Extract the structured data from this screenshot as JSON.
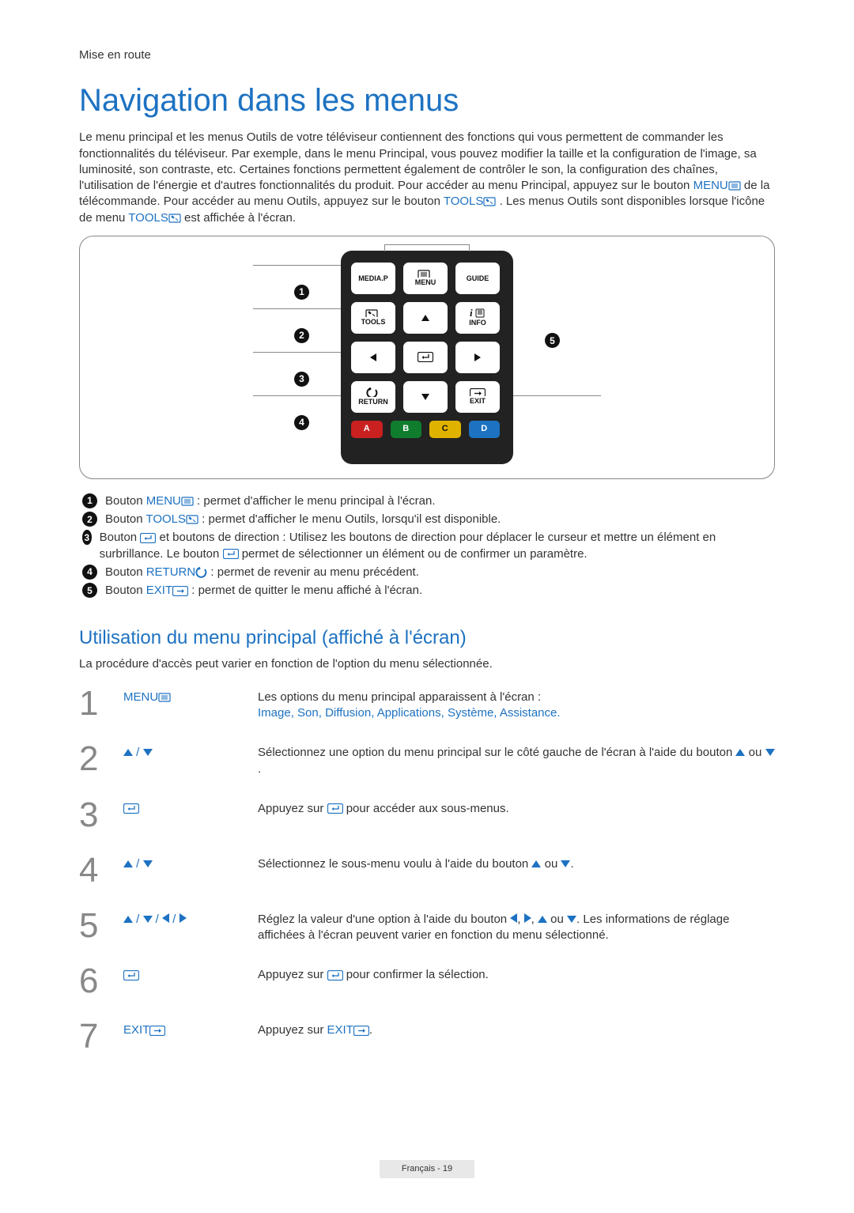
{
  "breadcrumb": "Mise en route",
  "title": "Navigation dans les menus",
  "intro": {
    "pre": "Le menu principal et les menus Outils de votre téléviseur contiennent des fonctions qui vous permettent de commander les fonctionnalités du téléviseur. Par exemple, dans le menu Principal, vous pouvez modifier la taille et la configuration de l'image, sa luminosité, son contraste, etc. Certaines fonctions permettent également de contrôler le son, la configuration des chaînes, l'utilisation de l'énergie et d'autres fonctionnalités du produit. Pour accéder au menu Principal, appuyez sur le bouton ",
    "menu": "MENU",
    "mid1": " de la télécommande. Pour accéder au menu Outils, appuyez sur le bouton ",
    "tools1": "TOOLS",
    "mid2": ". Les menus Outils sont disponibles lorsque l'icône de menu ",
    "tools2": "TOOLS",
    "post": " est affichée à l'écran."
  },
  "remote": {
    "mediap": "MEDIA.P",
    "menu": "MENU",
    "guide": "GUIDE",
    "tools": "TOOLS",
    "info": "INFO",
    "return": "RETURN",
    "exit": "EXIT",
    "a": "A",
    "b": "B",
    "c": "C",
    "d": "D"
  },
  "callouts": {
    "c1a": "Bouton ",
    "c1b": "MENU",
    "c1c": " : permet d'afficher le menu principal à l'écran.",
    "c2a": "Bouton ",
    "c2b": "TOOLS",
    "c2c": " : permet d'afficher le menu Outils, lorsqu'il est disponible.",
    "c3a": "Bouton ",
    "c3b": " et boutons de direction : Utilisez les boutons de direction pour déplacer le curseur et mettre un élément en surbrillance. Le bouton ",
    "c3c": " permet de sélectionner un élément ou de confirmer un paramètre.",
    "c4a": "Bouton ",
    "c4b": "RETURN",
    "c4c": " : permet de revenir au menu précédent.",
    "c5a": "Bouton ",
    "c5b": "EXIT",
    "c5c": " : permet de quitter le menu affiché à l'écran."
  },
  "subheading": "Utilisation du menu principal (affiché à l'écran)",
  "sublead": "La procédure d'accès peut varier en fonction de l'option du menu sélectionnée.",
  "steps": {
    "s1": {
      "n": "1",
      "key": "MENU",
      "pre": "Les options du menu principal apparaissent à l'écran :",
      "opts": [
        "Image",
        "Son",
        "Diffusion",
        "Applications",
        "Système",
        "Assistance"
      ]
    },
    "s2": {
      "n": "2",
      "d1": "Sélectionnez une option du menu principal sur le côté gauche de l'écran à l'aide du bouton ",
      "d2": " ou ",
      "d3": "."
    },
    "s3": {
      "n": "3",
      "d1": "Appuyez sur ",
      "d2": " pour accéder aux sous-menus."
    },
    "s4": {
      "n": "4",
      "d1": "Sélectionnez le sous-menu voulu à l'aide du bouton ",
      "d2": " ou ",
      "d3": "."
    },
    "s5": {
      "n": "5",
      "d1": "Réglez la valeur d'une option à l'aide du bouton ",
      "d2": ". Les informations de réglage affichées à l'écran peuvent varier en fonction du menu sélectionné."
    },
    "s6": {
      "n": "6",
      "d1": "Appuyez sur ",
      "d2": " pour confirmer la sélection."
    },
    "s7": {
      "n": "7",
      "key": "EXIT",
      "d1": "Appuyez sur ",
      "d2": "EXIT",
      "d3": "."
    }
  },
  "footer": {
    "lang": "Français",
    "page": "19"
  }
}
